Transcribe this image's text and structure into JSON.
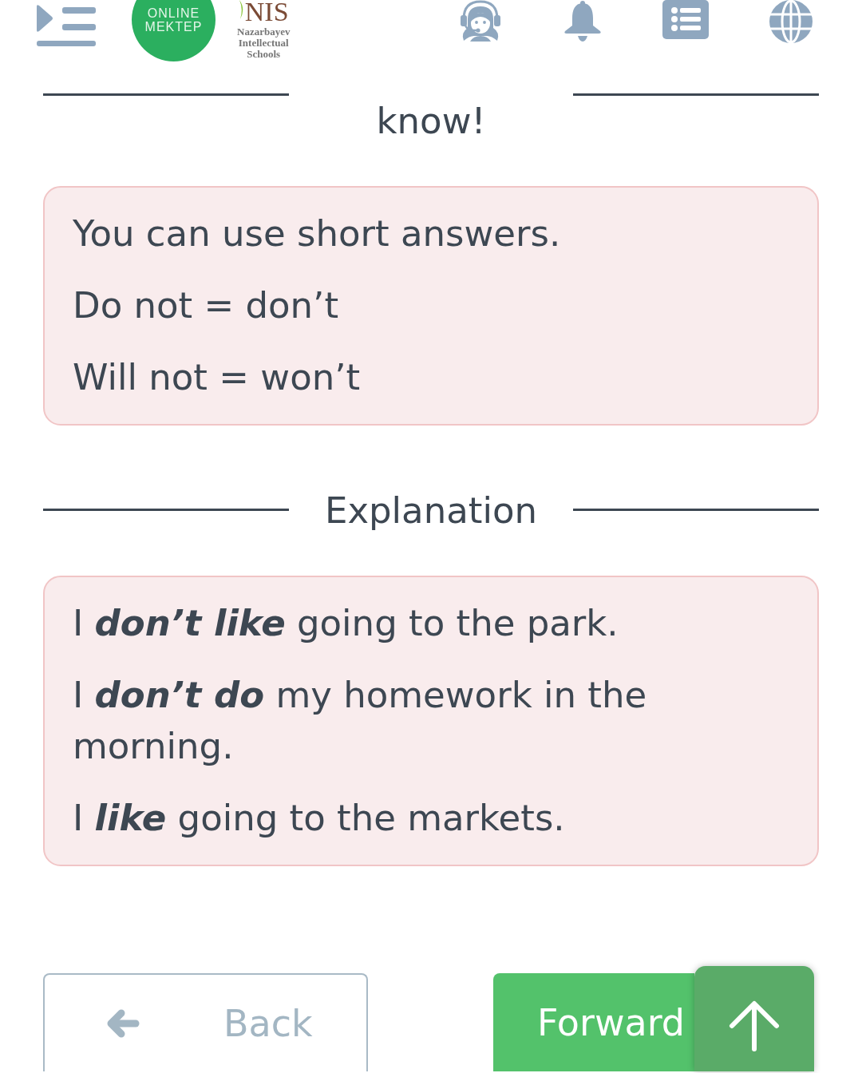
{
  "header": {
    "logo": {
      "lines": [
        "ONLINE",
        "MEKTEP"
      ]
    },
    "partner_logo": {
      "mark": "NIS",
      "lines": [
        "Nazarbayev",
        "Intellectual",
        "Schools"
      ]
    }
  },
  "sections": [
    {
      "heading": "know!",
      "lines": [
        "You can use short answers.",
        "Do not = don’t",
        "Will not = won’t"
      ]
    },
    {
      "heading": "Explanation",
      "lines": [
        "I **don’t like** going to the park.",
        "I **don’t do** my homework in the morning.",
        "I **like** going to the markets."
      ]
    }
  ],
  "navigation": {
    "back": "Back",
    "forward": "Forward"
  }
}
